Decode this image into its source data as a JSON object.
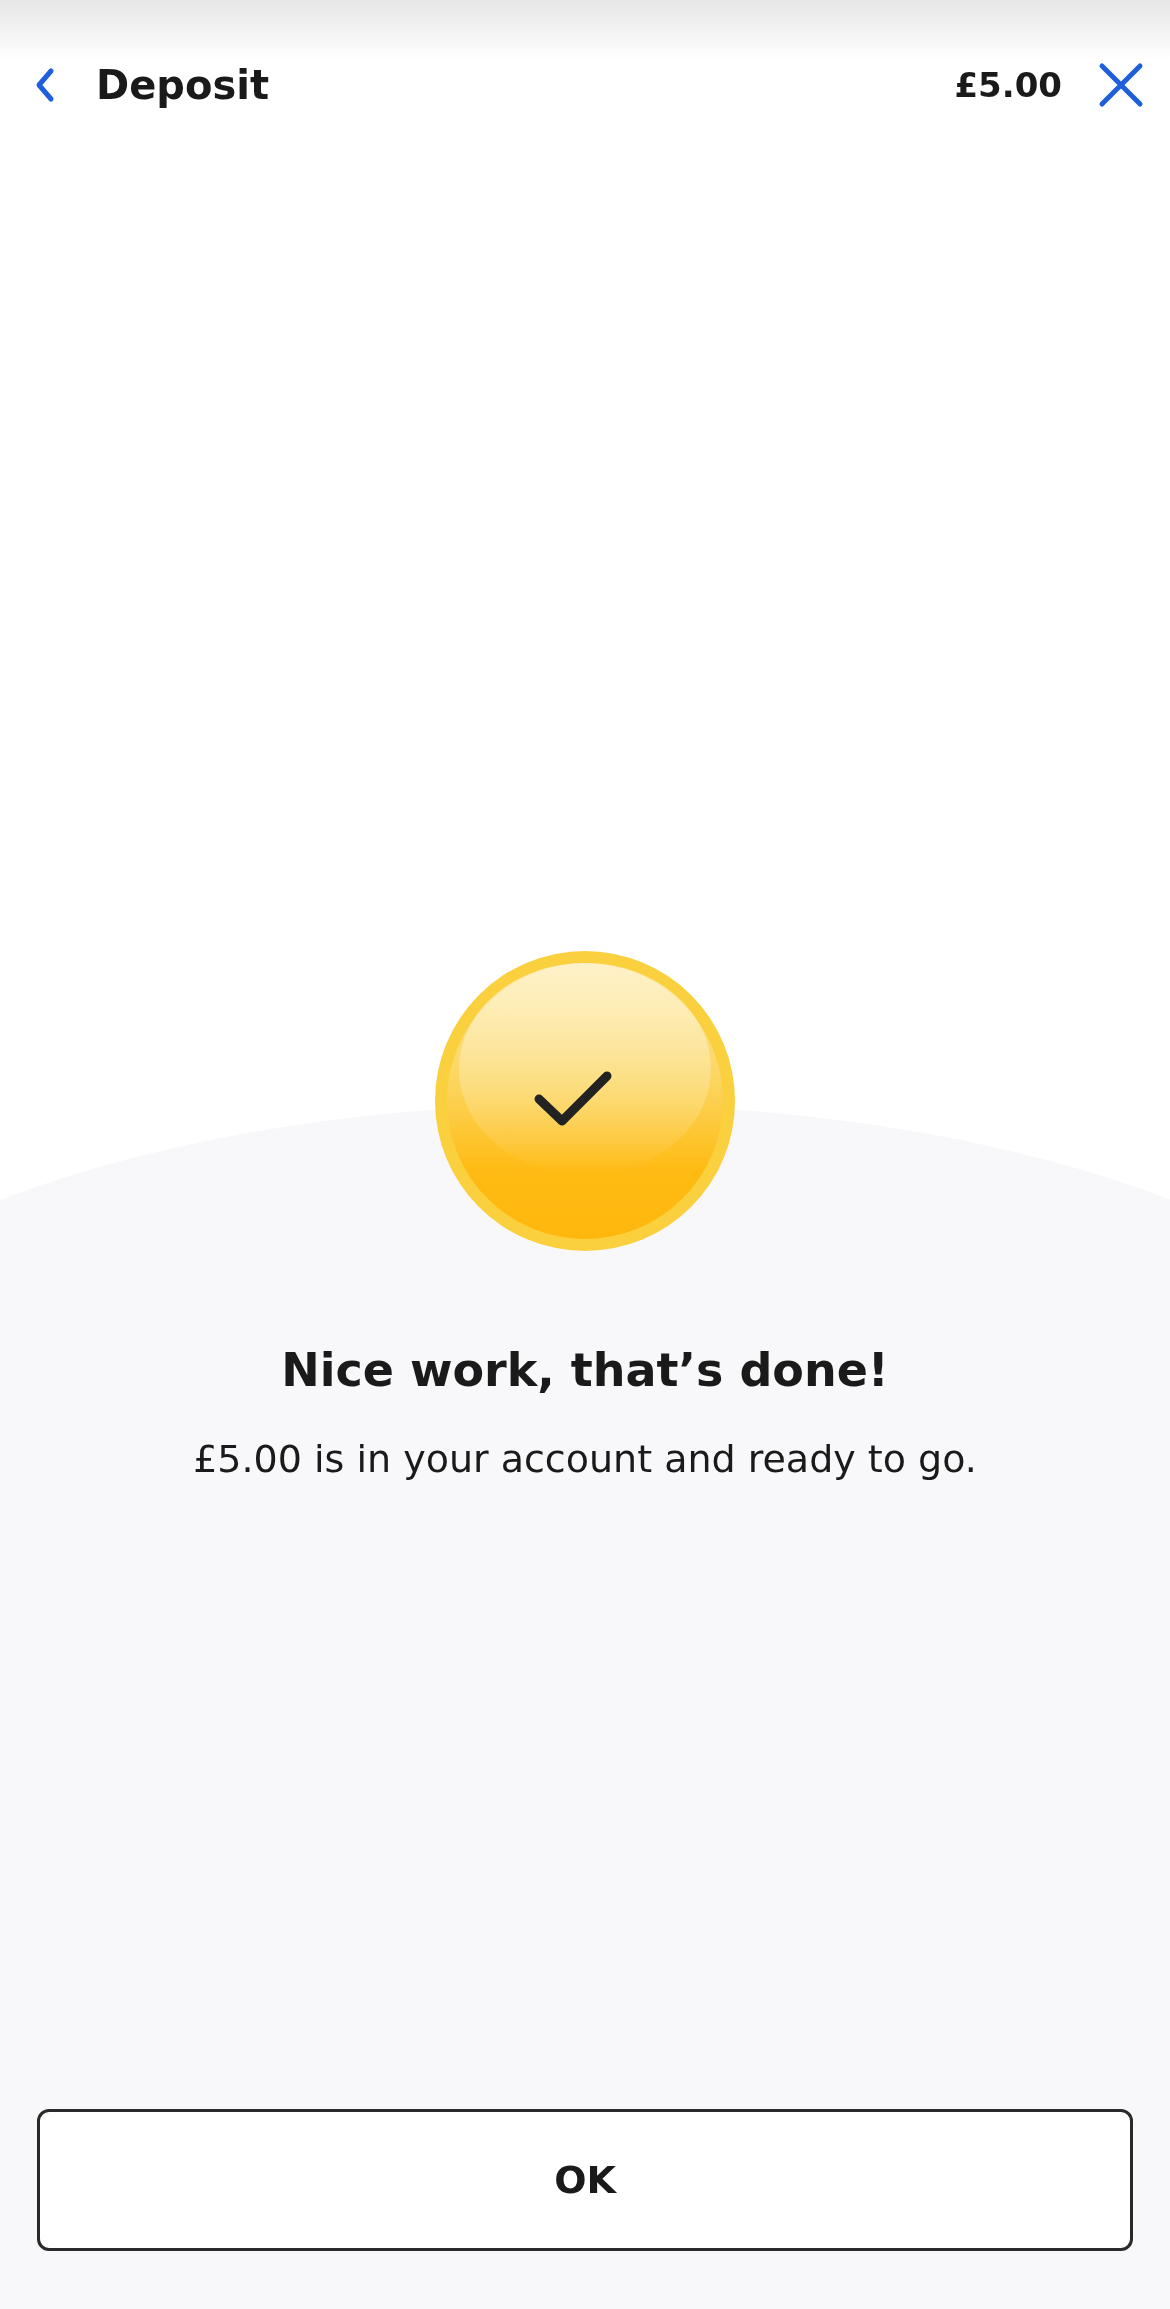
{
  "header": {
    "title": "Deposit",
    "amount": "£5.00"
  },
  "confirmation": {
    "title": "Nice work, that’s done!",
    "message": "£5.00 is in your account and ready to go."
  },
  "buttons": [
    {
      "label": "OK"
    }
  ]
}
